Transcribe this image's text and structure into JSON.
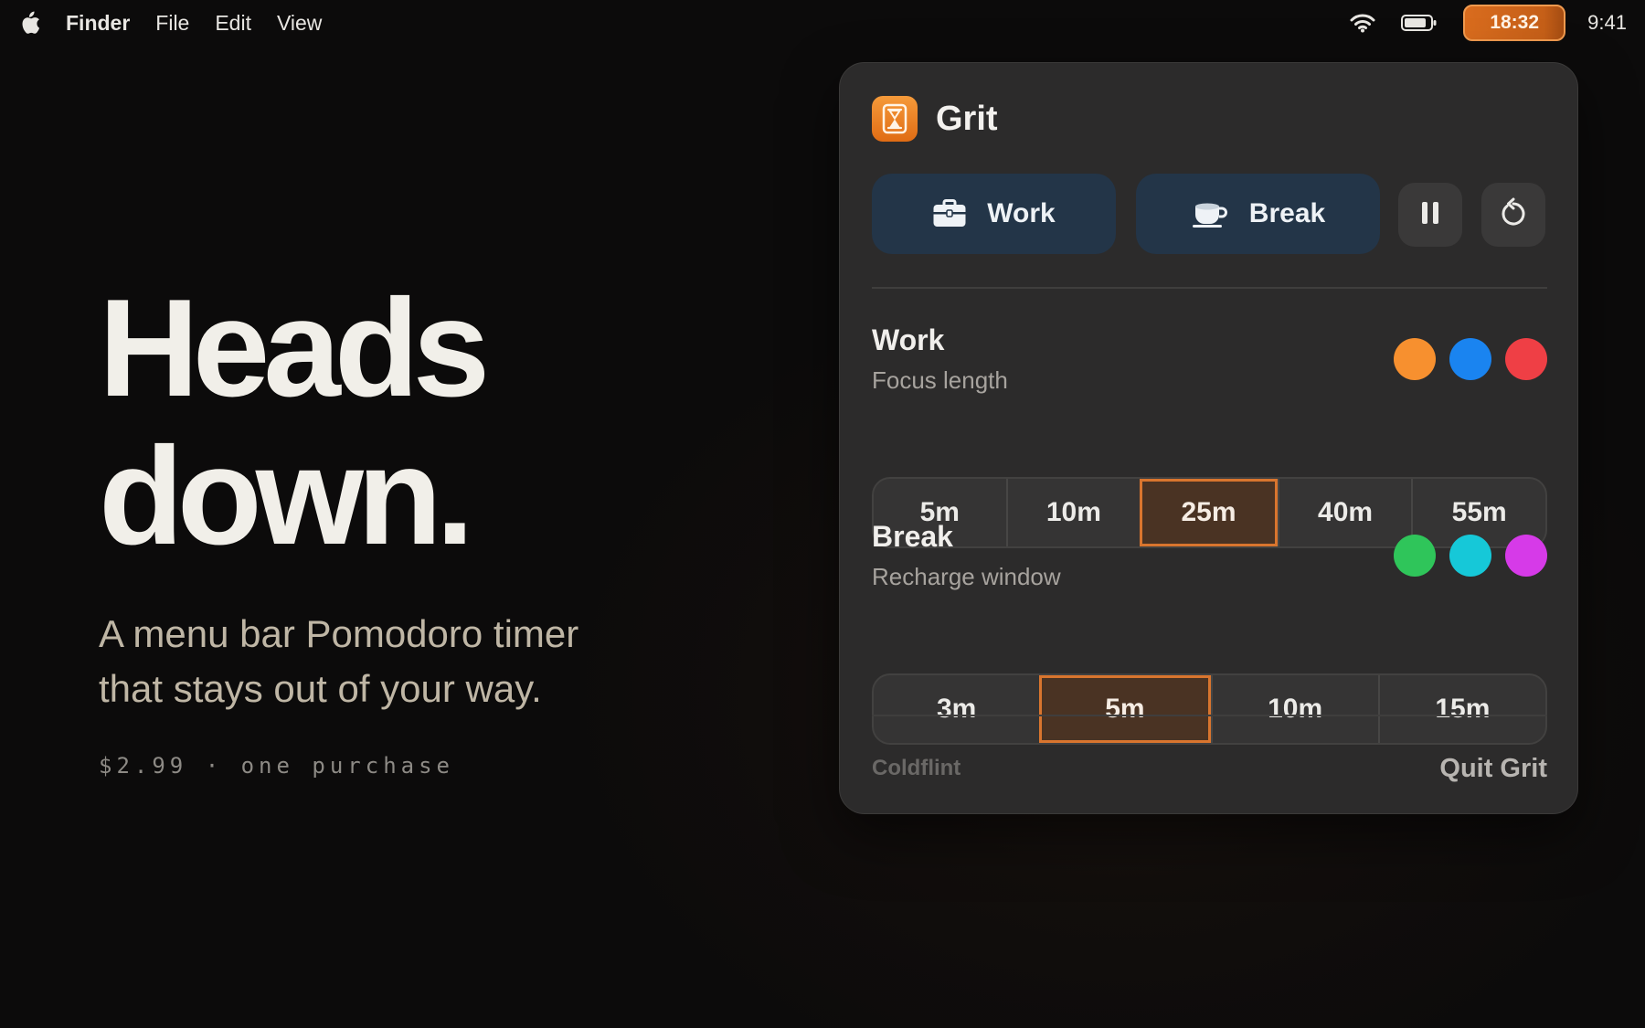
{
  "menubar": {
    "apple_icon": "apple-logo-icon",
    "app_name": "Finder",
    "menus": [
      "File",
      "Edit",
      "View"
    ],
    "status_icons": [
      "wifi-icon",
      "battery-icon"
    ],
    "timer_display": "18:32",
    "clock": "9:41"
  },
  "hero": {
    "title_line1": "Heads",
    "title_line2": "down.",
    "subtitle_line1": "A menu bar Pomodoro timer",
    "subtitle_line2": "that stays out of your way.",
    "price": "$2.99 · one purchase"
  },
  "popover": {
    "app_icon": "hourglass-icon",
    "app_name": "Grit",
    "buttons": {
      "work": {
        "label": "Work",
        "icon": "briefcase-icon"
      },
      "break": {
        "label": "Break",
        "icon": "coffee-cup-icon"
      },
      "pause_icon": "pause-icon",
      "reset_icon": "reset-icon"
    },
    "work_section": {
      "title": "Work",
      "subtitle": "Focus length",
      "colors": [
        "#f7902f",
        "#1a84f0",
        "#ef3f45"
      ],
      "options": [
        "5m",
        "10m",
        "25m",
        "40m",
        "55m"
      ],
      "selected": "25m"
    },
    "break_section": {
      "title": "Break",
      "subtitle": "Recharge window",
      "colors": [
        "#2fc55a",
        "#16c8d8",
        "#d63ae8"
      ],
      "options": [
        "3m",
        "5m",
        "10m",
        "15m"
      ],
      "selected": "5m"
    },
    "footer": {
      "brand": "Coldflint",
      "quit_label": "Quit Grit"
    }
  },
  "colors": {
    "accent": "#d9752e",
    "panel_bg": "#2c2b2b",
    "mode_button_bg": "#233548"
  }
}
